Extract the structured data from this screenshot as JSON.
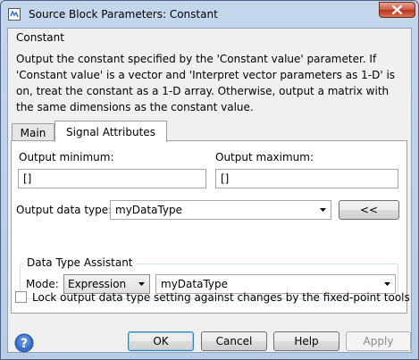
{
  "window": {
    "title": "Source Block Parameters: Constant",
    "app_icon": "simulink-block-icon",
    "close_icon": "close-icon"
  },
  "header": {
    "title": "Constant",
    "description": "Output the constant specified by the 'Constant value' parameter. If 'Constant value' is a vector and 'Interpret vector parameters as 1-D' is on, treat the constant as a 1-D array. Otherwise, output a matrix with the same dimensions as the constant value."
  },
  "tabs": [
    {
      "label": "Main",
      "active": false
    },
    {
      "label": "Signal Attributes",
      "active": true
    }
  ],
  "signal_attributes": {
    "output_minimum": {
      "label": "Output minimum:",
      "value": "[]"
    },
    "output_maximum": {
      "label": "Output maximum:",
      "value": "[]"
    },
    "output_data_type": {
      "label": "Output data type:",
      "value": "myDataType",
      "toggle_button_label": "<<"
    },
    "data_type_assistant": {
      "group_label": "Data Type Assistant",
      "mode_label": "Mode:",
      "mode_value": "Expression",
      "expression_value": "myDataType"
    },
    "lock_checkbox": {
      "label": "Lock output data type setting against changes by the fixed-point tools",
      "checked": false
    }
  },
  "footer": {
    "help_icon": "help-icon",
    "ok_label": "OK",
    "cancel_label": "Cancel",
    "help_label": "Help",
    "apply_label": "Apply"
  },
  "colors": {
    "window_frame": "#b7cce5",
    "close_button": "#c75a45",
    "default_button_border": "#3c7fb1",
    "help_icon_blue": "#3a6fc4"
  }
}
